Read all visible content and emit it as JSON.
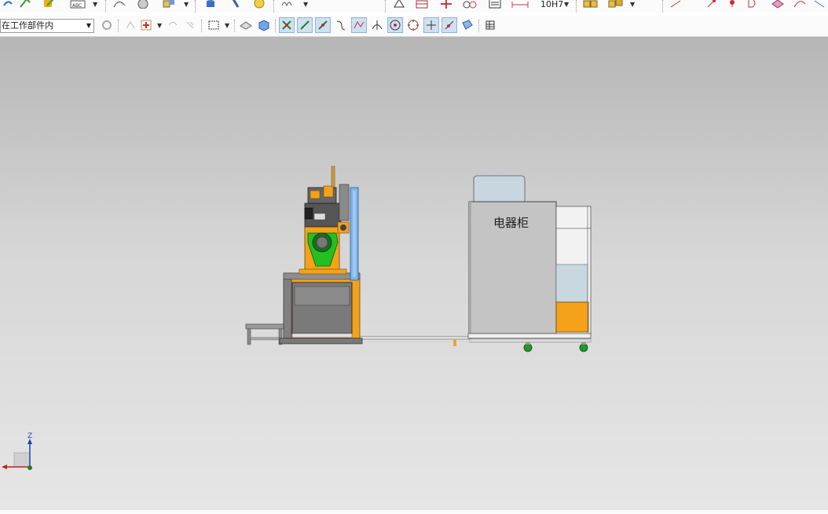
{
  "toolbar_top": {
    "tolerance_label": "10H7"
  },
  "selection_filter": {
    "value": "在工作部件内"
  },
  "model": {
    "cabinet_label": "电器柜"
  },
  "triad": {
    "z_label": "Z"
  },
  "colors": {
    "accent_orange": "#f5a21a",
    "robot_green": "#22c022",
    "cabinet_grey": "#c4c4c4",
    "wheel_green": "#1f9a2a",
    "rail_blue": "#7fb6e6"
  }
}
